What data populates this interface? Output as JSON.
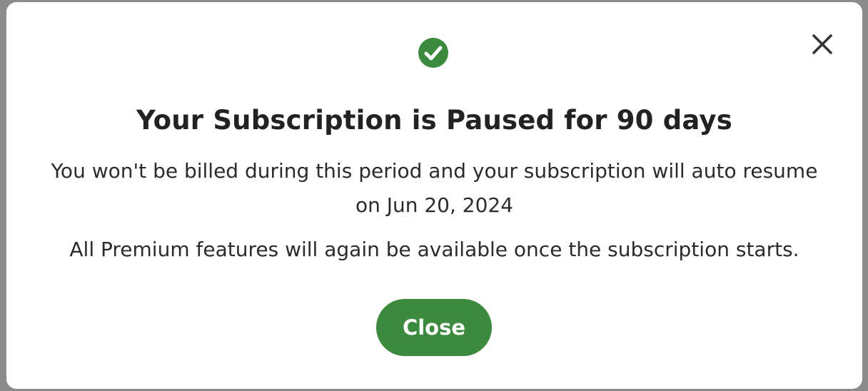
{
  "dialog": {
    "title": "Your Subscription is Paused for 90 days",
    "message": "You won't be billed during this period and your subscription will auto resume on Jun 20, 2024",
    "note": "All Premium features will again be available once the subscription starts.",
    "close_button_label": "Close",
    "status_icon": "check-circle-icon",
    "dismiss_icon": "close-icon"
  },
  "colors": {
    "accent": "#3b8a3e",
    "text": "#222222",
    "backdrop": "#8c8c8c",
    "surface": "#ffffff"
  }
}
